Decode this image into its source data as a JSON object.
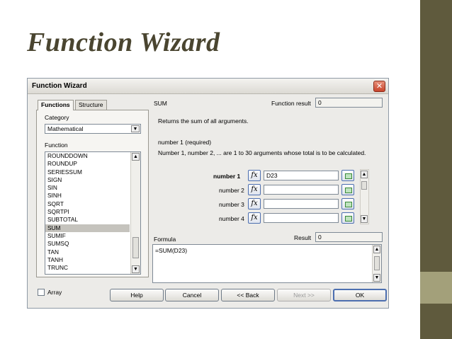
{
  "slide": {
    "title": "Function Wizard"
  },
  "dialog": {
    "title": "Function Wizard",
    "close_glyph": "✕",
    "tabs": [
      "Functions",
      "Structure"
    ],
    "category_label": "Category",
    "category_value": "Mathematical",
    "function_label": "Function",
    "functions": [
      "ROUNDDOWN",
      "ROUNDUP",
      "SERIESSUM",
      "SIGN",
      "SIN",
      "SINH",
      "SQRT",
      "SQRTPI",
      "SUBTOTAL",
      "SUM",
      "SUMIF",
      "SUMSQ",
      "TAN",
      "TANH",
      "TRUNC"
    ],
    "selected_function": "SUM",
    "fn_name": "SUM",
    "function_result_label": "Function result",
    "function_result_value": "0",
    "description": "Returns the sum of all arguments.",
    "arg_title": "number 1 (required)",
    "arg_desc": "Number 1, number 2, ... are 1 to 30 arguments whose total is to be calculated.",
    "args": [
      {
        "label": "number 1",
        "value": "D23"
      },
      {
        "label": "number 2",
        "value": ""
      },
      {
        "label": "number 3",
        "value": ""
      },
      {
        "label": "number 4",
        "value": ""
      }
    ],
    "fx_glyph": "fx",
    "formula_label": "Formula",
    "result_label": "Result",
    "result_value": "0",
    "formula_value": "=SUM(D23)",
    "array_label": "Array",
    "buttons": {
      "help": "Help",
      "cancel": "Cancel",
      "back": "<< Back",
      "next": "Next >>",
      "ok": "OK"
    },
    "scroll_up": "▲",
    "scroll_down": "▼",
    "combo_arrow": "▼"
  }
}
